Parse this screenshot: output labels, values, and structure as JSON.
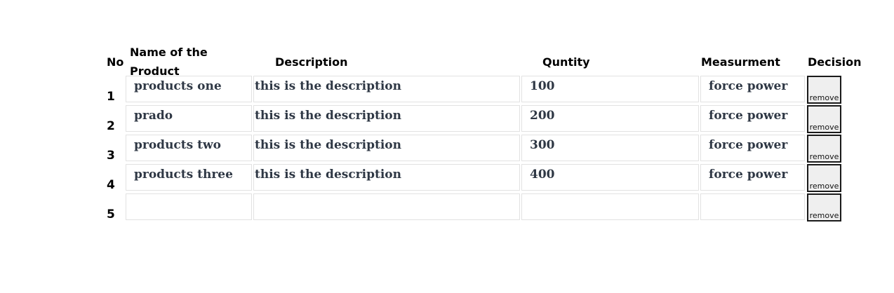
{
  "table": {
    "headers": {
      "no": "No",
      "name": "Name of the Product",
      "description": "Description",
      "quantity": "Quntity",
      "measurement": "Measurment",
      "decision": "Decision"
    },
    "rows": [
      {
        "no": "1",
        "name": "products one",
        "description": "this is the description",
        "quantity": "100",
        "measurement": "force power",
        "action": "remove"
      },
      {
        "no": "2",
        "name": "prado",
        "description": "this is the description",
        "quantity": "200",
        "measurement": "force power",
        "action": "remove"
      },
      {
        "no": "3",
        "name": "products two",
        "description": "this is the description",
        "quantity": "300",
        "measurement": "force power",
        "action": "remove"
      },
      {
        "no": "4",
        "name": "products three",
        "description": "this is the description",
        "quantity": "400",
        "measurement": "force power",
        "action": "remove"
      },
      {
        "no": "5",
        "name": "",
        "description": "",
        "quantity": "",
        "measurement": "",
        "action": "remove"
      }
    ]
  },
  "colors": {
    "cell_text": "#2f3845",
    "cell_border": "#e2e2e2",
    "button_bg": "#efefef",
    "button_border": "#1a1a1a"
  }
}
